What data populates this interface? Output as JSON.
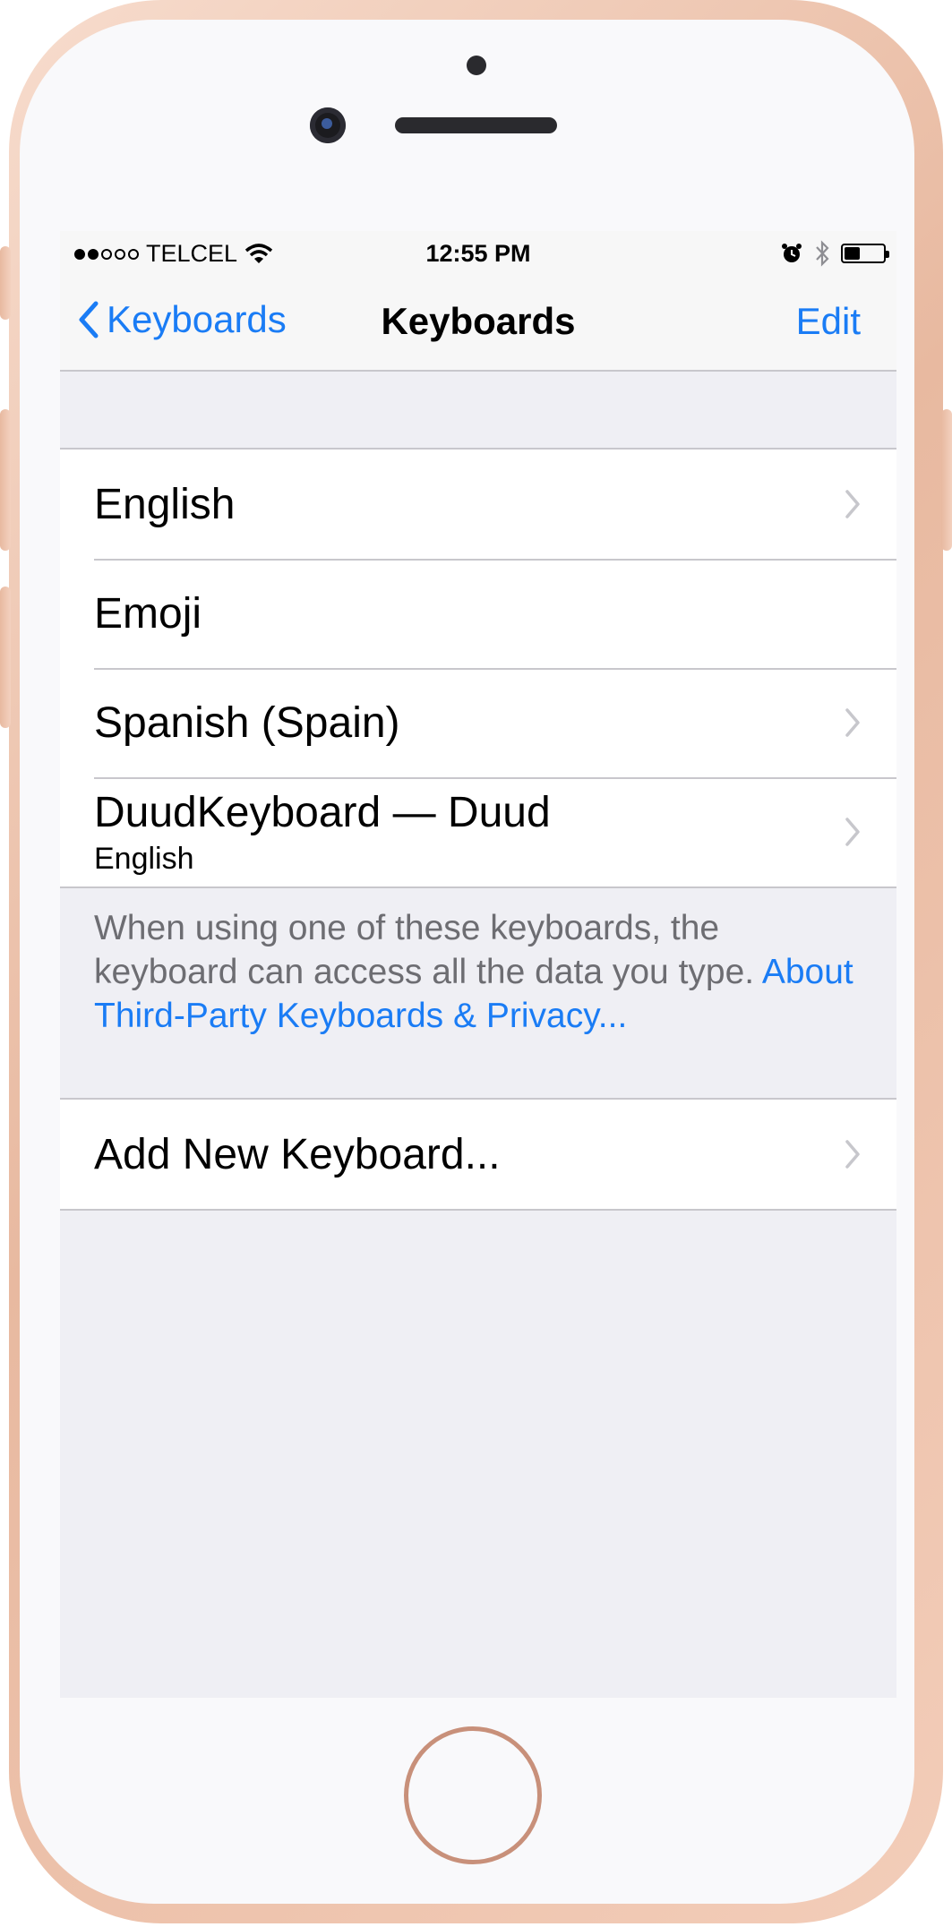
{
  "status_bar": {
    "carrier": "TELCEL",
    "time": "12:55 PM",
    "signal_bars": 2,
    "battery_level": 0.4
  },
  "nav": {
    "back_label": "Keyboards",
    "title": "Keyboards",
    "edit_label": "Edit"
  },
  "keyboards": [
    {
      "label": "English",
      "subtitle": "",
      "has_chevron": true
    },
    {
      "label": "Emoji",
      "subtitle": "",
      "has_chevron": false
    },
    {
      "label": "Spanish (Spain)",
      "subtitle": "",
      "has_chevron": true
    },
    {
      "label": "DuudKeyboard — Duud",
      "subtitle": "English",
      "has_chevron": true
    }
  ],
  "footer": {
    "note": "When using one of these keyboards, the keyboard can access all the data you type.",
    "link": "About Third-Party Keyboards & Privacy..."
  },
  "add_keyboard_label": "Add New Keyboard...",
  "colors": {
    "accent": "#1a7cf5",
    "background": "#efeff4",
    "separator": "#c8c7cc"
  }
}
